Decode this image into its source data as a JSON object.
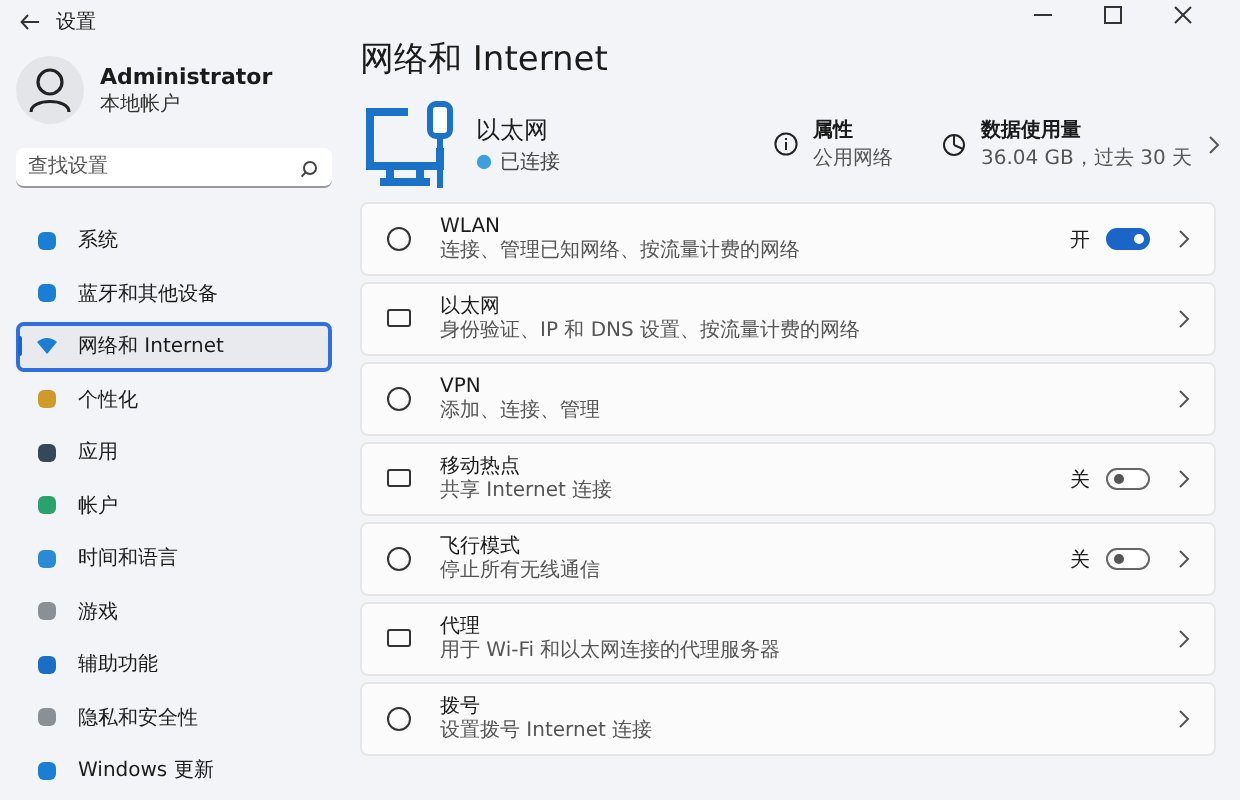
{
  "window": {
    "title": "设置"
  },
  "account": {
    "name": "Administrator",
    "type": "本地帐户"
  },
  "search": {
    "placeholder": "查找设置"
  },
  "sidebar": {
    "items": [
      {
        "label": "系统",
        "selected": false
      },
      {
        "label": "蓝牙和其他设备",
        "selected": false
      },
      {
        "label": "网络和 Internet",
        "selected": true
      },
      {
        "label": "个性化",
        "selected": false
      },
      {
        "label": "应用",
        "selected": false
      },
      {
        "label": "帐户",
        "selected": false
      },
      {
        "label": "时间和语言",
        "selected": false
      },
      {
        "label": "游戏",
        "selected": false
      },
      {
        "label": "辅助功能",
        "selected": false
      },
      {
        "label": "隐私和安全性",
        "selected": false
      },
      {
        "label": "Windows 更新",
        "selected": false
      }
    ]
  },
  "page_title": "网络和 Internet",
  "connection": {
    "name": "以太网",
    "status": "已连接",
    "properties": {
      "title": "属性",
      "value": "公用网络"
    },
    "data_usage": {
      "title": "数据使用量",
      "value": "36.04 GB，过去 30 天"
    }
  },
  "settings": [
    {
      "title": "WLAN",
      "description": "连接、管理已知网络、按流量计费的网络",
      "kind": "toggle",
      "on": true,
      "state_label": "开"
    },
    {
      "title": "以太网",
      "description": "身份验证、IP 和 DNS 设置、按流量计费的网络",
      "kind": "link"
    },
    {
      "title": "VPN",
      "description": "添加、连接、管理",
      "kind": "link"
    },
    {
      "title": "移动热点",
      "description": "共享 Internet 连接",
      "kind": "toggle",
      "on": false,
      "state_label": "关"
    },
    {
      "title": "飞行模式",
      "description": "停止所有无线通信",
      "kind": "toggle",
      "on": false,
      "state_label": "关"
    },
    {
      "title": "代理",
      "description": "用于 Wi-Fi 和以太网连接的代理服务器",
      "kind": "link"
    },
    {
      "title": "拨号",
      "description": "设置拨号 Internet 连接",
      "kind": "link"
    }
  ]
}
